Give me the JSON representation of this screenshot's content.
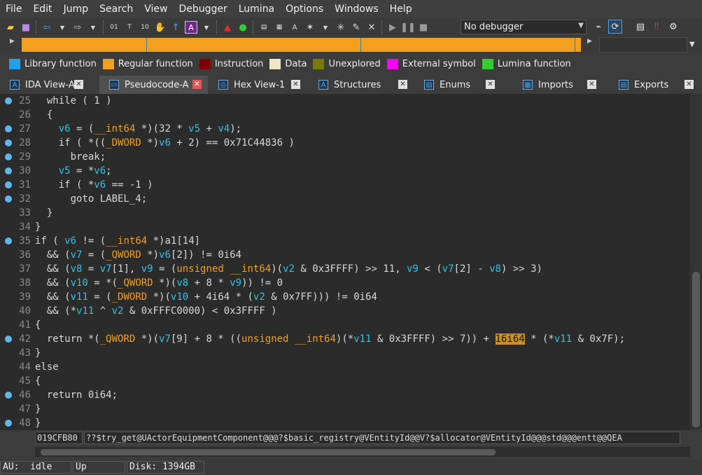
{
  "menu": [
    "File",
    "Edit",
    "Jump",
    "Search",
    "View",
    "Debugger",
    "Lumina",
    "Options",
    "Windows",
    "Help"
  ],
  "toolbar": {
    "debugger_select": "No debugger"
  },
  "legend": [
    {
      "label": "Library function",
      "color": "#1da1f2"
    },
    {
      "label": "Regular function",
      "color": "#f2a01e"
    },
    {
      "label": "Instruction",
      "color": "#800000"
    },
    {
      "label": "Data",
      "color": "#ebe6c3"
    },
    {
      "label": "Unexplored",
      "color": "#7b7b00"
    },
    {
      "label": "External symbol",
      "color": "#ff00ff"
    },
    {
      "label": "Lumina function",
      "color": "#33cc33"
    }
  ],
  "tabs": [
    {
      "label": "IDA View-A",
      "active": false
    },
    {
      "label": "Pseudocode-A",
      "active": true
    },
    {
      "label": "Hex View-1",
      "active": false
    },
    {
      "label": "Structures",
      "active": false
    },
    {
      "label": "Enums",
      "active": false
    },
    {
      "label": "Imports",
      "active": false
    },
    {
      "label": "Exports",
      "active": false
    }
  ],
  "code": [
    {
      "n": "25",
      "dot": true,
      "text": "  while ( 1 )"
    },
    {
      "n": "26",
      "dot": false,
      "text": "  {"
    },
    {
      "n": "27",
      "dot": true,
      "text": "    v6 = (__int64 *)(32 * v5 + v4);"
    },
    {
      "n": "28",
      "dot": true,
      "text": "    if ( *((_DWORD *)v6 + 2) == 0x71C44836 )"
    },
    {
      "n": "29",
      "dot": true,
      "text": "      break;"
    },
    {
      "n": "30",
      "dot": true,
      "text": "    v5 = *v6;"
    },
    {
      "n": "31",
      "dot": true,
      "text": "    if ( *v6 == -1 )"
    },
    {
      "n": "32",
      "dot": true,
      "text": "      goto LABEL_4;"
    },
    {
      "n": "33",
      "dot": false,
      "text": "  }"
    },
    {
      "n": "34",
      "dot": false,
      "text": "}"
    },
    {
      "n": "35",
      "dot": true,
      "text": "if ( v6 != (__int64 *)a1[14]"
    },
    {
      "n": "36",
      "dot": false,
      "text": "  && (v7 = (_QWORD *)v6[2]) != 0i64"
    },
    {
      "n": "37",
      "dot": false,
      "text": "  && (v8 = v7[1], v9 = (unsigned __int64)(v2 & 0x3FFFF) >> 11, v9 < (v7[2] - v8) >> 3)"
    },
    {
      "n": "38",
      "dot": false,
      "text": "  && (v10 = *(_QWORD *)(v8 + 8 * v9)) != 0"
    },
    {
      "n": "39",
      "dot": false,
      "text": "  && (v11 = (_DWORD *)(v10 + 4i64 * (v2 & 0x7FF))) != 0i64"
    },
    {
      "n": "40",
      "dot": false,
      "text": "  && (*v11 ^ v2 & 0xFFFC0000) < 0x3FFFF )"
    },
    {
      "n": "41",
      "dot": false,
      "text": "{"
    },
    {
      "n": "42",
      "dot": true,
      "text": "  return *(_QWORD *)(v7[9] + 8 * ((unsigned __int64)(*v11 & 0x3FFFF) >> 7)) + 16i64 * (*v11 & 0x7F);"
    },
    {
      "n": "43",
      "dot": false,
      "text": "}"
    },
    {
      "n": "44",
      "dot": false,
      "text": "else"
    },
    {
      "n": "45",
      "dot": false,
      "text": "{"
    },
    {
      "n": "46",
      "dot": true,
      "text": "  return 0i64;"
    },
    {
      "n": "47",
      "dot": false,
      "text": "}"
    },
    {
      "n": "48",
      "dot": true,
      "text": "}"
    }
  ],
  "highlight_token": "16i64",
  "status": {
    "address": "019CFB80",
    "function": "??$try_get@UActorEquipmentComponent@@@?$basic_registry@VEntityId@@V?$allocator@VEntityId@@@std@@@entt@@QEA"
  },
  "bottom": {
    "au": "AU:",
    "au_state": "idle",
    "direction": "Up",
    "disk": "Disk: 1394GB"
  }
}
